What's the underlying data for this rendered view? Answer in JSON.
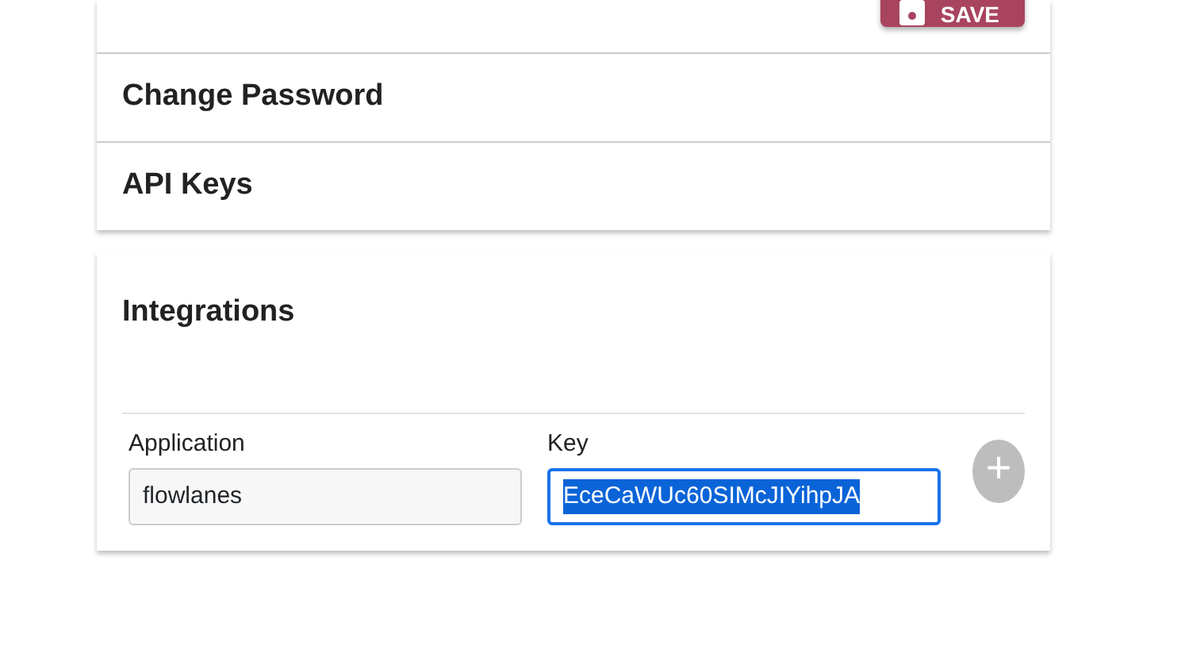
{
  "top_panel": {
    "save_button": {
      "label": "SAVE"
    }
  },
  "sections": [
    {
      "title": "Change Password",
      "expanded": false
    },
    {
      "title": "API Keys",
      "expanded": false
    }
  ],
  "integrations": {
    "title": "Integrations",
    "columns": [
      "Application",
      "Key"
    ],
    "rows": [
      {
        "application": "flowlanes",
        "key": "EceCaWUc60SIMcJIYihpJA",
        "key_focused": true,
        "key_selected": true
      }
    ],
    "add_button": {
      "label": "+",
      "disabled": true
    }
  }
}
